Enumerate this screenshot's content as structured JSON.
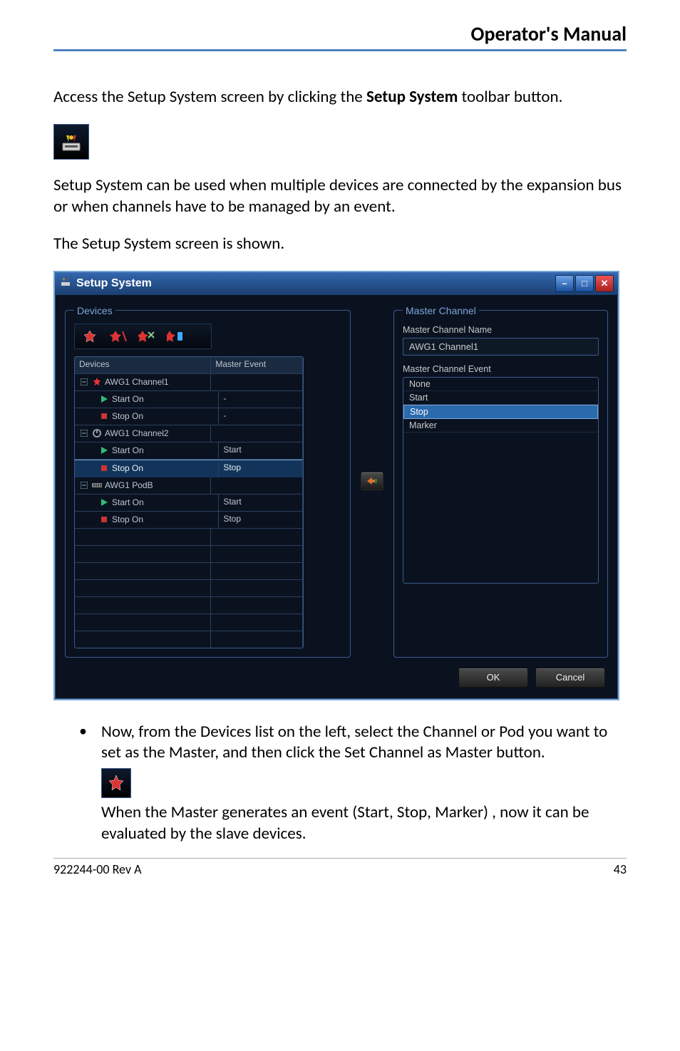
{
  "header": {
    "title": "Operator's Manual"
  },
  "p1_a": "Access the Setup System screen by clicking the ",
  "p1_b": "Setup System",
  "p1_c": " toolbar button.",
  "p2": "Setup System can be used when multiple devices are connected by the expansion bus or when channels have to be managed by an event.",
  "p3": "The Setup System screen is shown.",
  "window": {
    "title": "Setup System",
    "devices_legend": "Devices",
    "columns": {
      "devices": "Devices",
      "master_event": "Master Event"
    },
    "rows": [
      {
        "label": "AWG1 Channel1",
        "me": "",
        "kind": "channel-master"
      },
      {
        "label": "Start On",
        "me": "-",
        "kind": "start",
        "child": true
      },
      {
        "label": "Stop On",
        "me": "-",
        "kind": "stop",
        "child": true
      },
      {
        "label": "AWG1 Channel2",
        "me": "",
        "kind": "channel-off"
      },
      {
        "label": "Start On",
        "me": "Start",
        "kind": "start",
        "child": true
      },
      {
        "label": "Stop On",
        "me": "Stop",
        "kind": "stop",
        "child": true,
        "selected": true
      },
      {
        "label": "AWG1 PodB",
        "me": "",
        "kind": "pod"
      },
      {
        "label": "Start On",
        "me": "Start",
        "kind": "start",
        "child": true
      },
      {
        "label": "Stop On",
        "me": "Stop",
        "kind": "stop",
        "child": true
      }
    ],
    "master_legend": "Master Channel",
    "master_name_label": "Master Channel Name",
    "master_name_value": "AWG1 Channel1",
    "master_event_label": "Master Channel Event",
    "master_event_options": [
      {
        "label": "None"
      },
      {
        "label": "Start"
      },
      {
        "label": "Stop",
        "selected": true
      },
      {
        "label": "Marker"
      }
    ],
    "ok": "OK",
    "cancel": "Cancel"
  },
  "bullet": {
    "p_a": "Now, from the Devices list on the left, select the Channel or Pod you want to set as the Master, and then click the ",
    "p_b": "Set Channel as Master",
    "p_c": " button.",
    "p2": "When the Master generates an event (Start, Stop, Marker) , now it can be evaluated by the slave devices."
  },
  "footer": {
    "left": "922244-00 Rev A",
    "right": "43"
  }
}
